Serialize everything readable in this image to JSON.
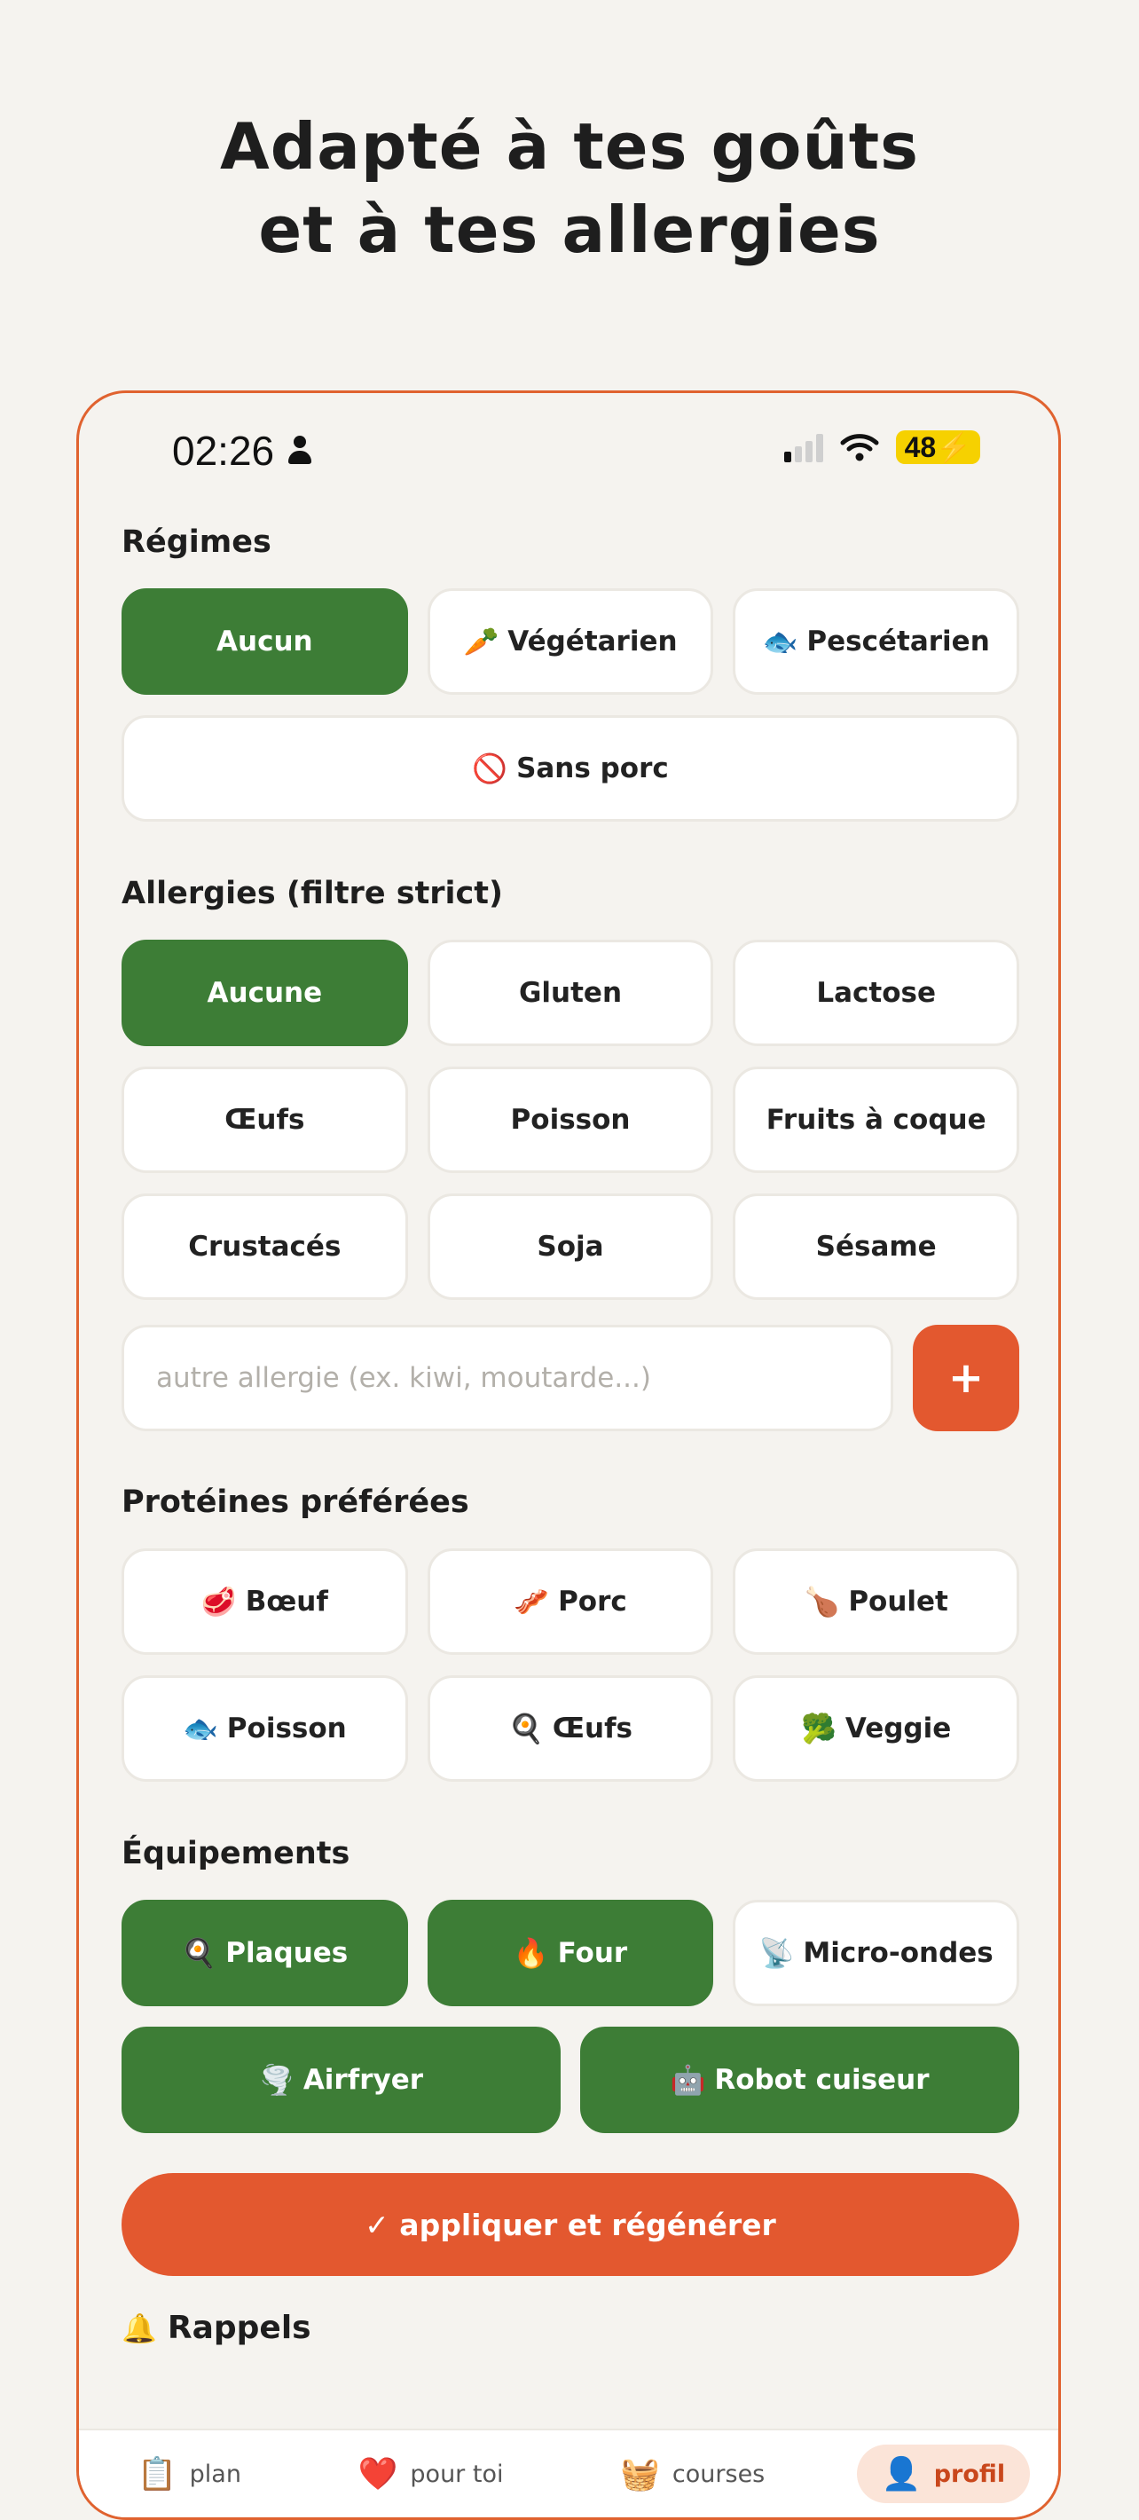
{
  "hero": {
    "line1": "Adapté à tes goûts",
    "line2": "et à tes allergies"
  },
  "status": {
    "time": "02:26",
    "battery": "48"
  },
  "regimes": {
    "title": "Régimes",
    "options": [
      {
        "emoji": "",
        "label": "Aucun",
        "selected": true
      },
      {
        "emoji": "🥕",
        "label": "Végétarien",
        "selected": false
      },
      {
        "emoji": "🐟",
        "label": "Pescétarien",
        "selected": false
      },
      {
        "emoji": "🚫",
        "label": "Sans porc",
        "selected": false
      }
    ]
  },
  "allergies": {
    "title": "Allergies (filtre strict)",
    "options": [
      {
        "label": "Aucune",
        "selected": true
      },
      {
        "label": "Gluten",
        "selected": false
      },
      {
        "label": "Lactose",
        "selected": false
      },
      {
        "label": "Œufs",
        "selected": false
      },
      {
        "label": "Poisson",
        "selected": false
      },
      {
        "label": "Fruits à coque",
        "selected": false
      },
      {
        "label": "Crustacés",
        "selected": false
      },
      {
        "label": "Soja",
        "selected": false
      },
      {
        "label": "Sésame",
        "selected": false
      }
    ],
    "input_placeholder": "autre allergie (ex. kiwi, moutarde...)",
    "input_value": "",
    "add_label": "+"
  },
  "proteins": {
    "title": "Protéines préférées",
    "options": [
      {
        "emoji": "🥩",
        "label": "Bœuf",
        "selected": false
      },
      {
        "emoji": "🥓",
        "label": "Porc",
        "selected": false
      },
      {
        "emoji": "🍗",
        "label": "Poulet",
        "selected": false
      },
      {
        "emoji": "🐟",
        "label": "Poisson",
        "selected": false
      },
      {
        "emoji": "🍳",
        "label": "Œufs",
        "selected": false
      },
      {
        "emoji": "🥦",
        "label": "Veggie",
        "selected": false
      }
    ]
  },
  "equipment": {
    "title": "Équipements",
    "options": [
      {
        "emoji": "🍳",
        "label": "Plaques",
        "selected": true
      },
      {
        "emoji": "🔥",
        "label": "Four",
        "selected": true
      },
      {
        "emoji": "📡",
        "label": "Micro-ondes",
        "selected": false
      },
      {
        "emoji": "🌪️",
        "label": "Airfryer",
        "selected": true
      },
      {
        "emoji": "🤖",
        "label": "Robot cuiseur",
        "selected": true
      }
    ]
  },
  "apply_label": "✓ appliquer et régénérer",
  "reminders": {
    "emoji": "🔔",
    "title": "Rappels"
  },
  "tabs": [
    {
      "emoji": "📋",
      "label": "plan",
      "active": false
    },
    {
      "emoji": "❤️",
      "label": "pour toi",
      "active": false
    },
    {
      "emoji": "🧺",
      "label": "courses",
      "active": false
    },
    {
      "emoji": "👤",
      "label": "profil",
      "active": true
    }
  ],
  "colors": {
    "selected": "#3d7d36",
    "accent": "#e3582f",
    "frame": "#e0622f",
    "background": "#f5f3ef"
  }
}
